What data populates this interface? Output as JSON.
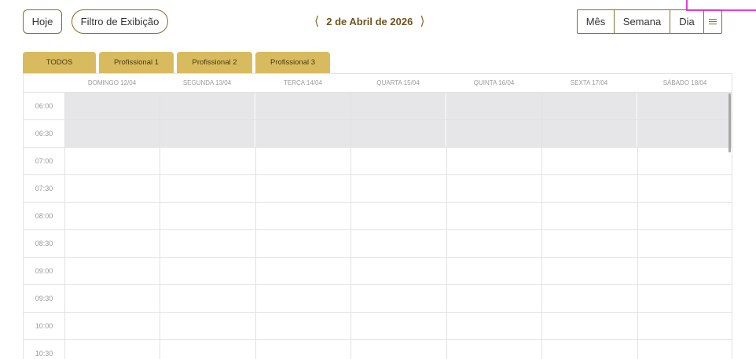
{
  "toolbar": {
    "today_label": "Hoje",
    "filter_label": "Filtro de Exibição",
    "prev_icon": "chevron-left-icon",
    "current_date": "2 de Abril de 2026",
    "next_icon": "chevron-right-icon",
    "views": [
      "Mês",
      "Semana",
      "Dia"
    ],
    "list_icon": "list-icon"
  },
  "tabs": [
    "TODOS",
    "Profissional 1",
    "Profissional 2",
    "Profissional 3"
  ],
  "days": [
    "DOMINGO 12/04",
    "SEGUNDA 13/04",
    "TERÇA 14/04",
    "QUARTA 15/04",
    "QUINTA 16/04",
    "SEXTA 17/04",
    "SÁBADO 18/04"
  ],
  "times": [
    "06:00",
    "06:30",
    "07:00",
    "07:30",
    "08:00",
    "08:30",
    "09:00",
    "09:30",
    "10:00",
    "10:30"
  ],
  "colors": {
    "accent": "#8a6d2b",
    "tab": "#d9bb5f",
    "off_hours": "#e6e6e8",
    "highlight": "#e83fd8"
  }
}
